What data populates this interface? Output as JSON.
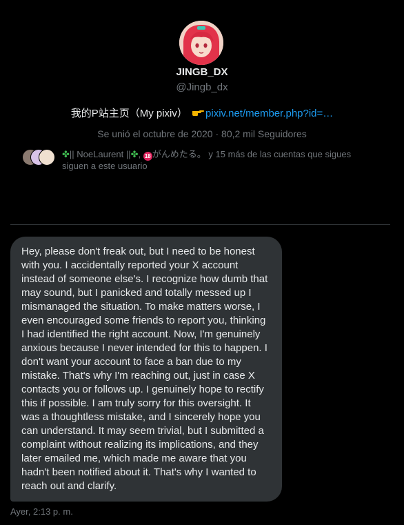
{
  "profile": {
    "display_name": "JINGB_DX",
    "handle": "@Jingb_dx",
    "bio_text": "我的P站主页（My pixiv）",
    "bio_link": "pixiv.net/member.php?id=…",
    "pointing_icon": "pointing-hand-icon",
    "joined": "Se unió el octubre de 2020 · 80,2 mil Seguidores"
  },
  "followers": {
    "name_prefix": "✤||",
    "name": "NoeLaurent",
    "name_suffix": "||✤",
    "separator": ",",
    "badge": "18",
    "second_name": "がんめたる。",
    "rest": "y 15 más de las cuentas que sigues siguen a este usuario"
  },
  "message": {
    "text": "Hey, please don't freak out, but I need to be honest with you. I accidentally reported your X account instead of someone else's. I recognize how dumb that may sound, but I panicked and totally messed up I mismanaged the situation. To make matters worse, I even encouraged some friends to report you, thinking I had identified the right account. Now, I'm genuinely anxious because I never intended for this to happen. I don't want your account to face a ban due to my mistake. That's why I'm reaching out, just in case X contacts you or follows up. I genuinely hope to rectify this if possible. I am truly sorry for this oversight. It was a thoughtless mistake, and I sincerely hope you can understand. It may seem trivial, but I submitted a complaint without realizing its implications, and they later emailed me, which made me aware that you hadn't been notified about it. That's why I wanted to reach out and clarify.",
    "timestamp": "Ayer, 2:13 p. m."
  },
  "colors": {
    "background": "#000000",
    "bubble": "#2f3336",
    "link": "#1d9bf0",
    "muted": "#71767b"
  }
}
